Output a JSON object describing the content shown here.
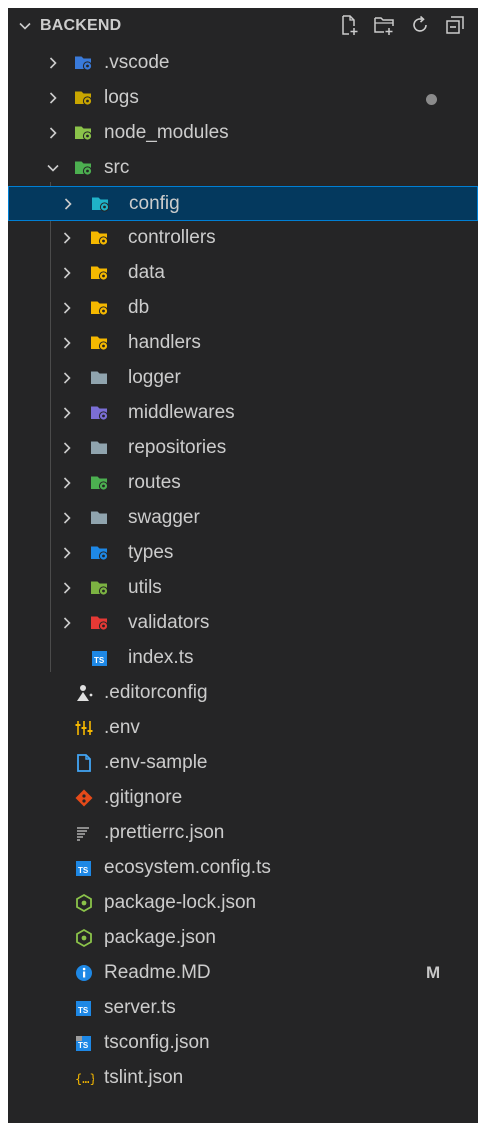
{
  "explorer": {
    "title": "BACKEND",
    "actions": [
      {
        "name": "new-file-icon"
      },
      {
        "name": "new-folder-icon"
      },
      {
        "name": "refresh-icon"
      },
      {
        "name": "collapse-all-icon"
      }
    ]
  },
  "tree": [
    {
      "label": ".vscode",
      "type": "folder",
      "expanded": false,
      "depth": 1,
      "icon": "folder-vscode-icon",
      "color": "#3a7ad9"
    },
    {
      "label": "logs",
      "type": "folder",
      "expanded": false,
      "depth": 1,
      "icon": "folder-logs-icon",
      "color": "#c9a600",
      "dot": true
    },
    {
      "label": "node_modules",
      "type": "folder",
      "expanded": false,
      "depth": 1,
      "icon": "folder-node-icon",
      "color": "#8bc34a"
    },
    {
      "label": "src",
      "type": "folder",
      "expanded": true,
      "depth": 1,
      "icon": "folder-src-icon",
      "color": "#4caf50"
    },
    {
      "label": "config",
      "type": "folder",
      "expanded": false,
      "depth": 2,
      "icon": "folder-config-icon",
      "color": "#20b2c8",
      "selected": true
    },
    {
      "label": "controllers",
      "type": "folder",
      "expanded": false,
      "depth": 2,
      "icon": "folder-controllers-icon",
      "color": "#f5b800"
    },
    {
      "label": "data",
      "type": "folder",
      "expanded": false,
      "depth": 2,
      "icon": "folder-data-icon",
      "color": "#f5b800"
    },
    {
      "label": "db",
      "type": "folder",
      "expanded": false,
      "depth": 2,
      "icon": "folder-db-icon",
      "color": "#f5b800"
    },
    {
      "label": "handlers",
      "type": "folder",
      "expanded": false,
      "depth": 2,
      "icon": "folder-handlers-icon",
      "color": "#f5b800"
    },
    {
      "label": "logger",
      "type": "folder",
      "expanded": false,
      "depth": 2,
      "icon": "folder-icon",
      "color": "#90a4ae"
    },
    {
      "label": "middlewares",
      "type": "folder",
      "expanded": false,
      "depth": 2,
      "icon": "folder-middlewares-icon",
      "color": "#7b6fd6"
    },
    {
      "label": "repositories",
      "type": "folder",
      "expanded": false,
      "depth": 2,
      "icon": "folder-icon",
      "color": "#90a4ae"
    },
    {
      "label": "routes",
      "type": "folder",
      "expanded": false,
      "depth": 2,
      "icon": "folder-routes-icon",
      "color": "#4caf50"
    },
    {
      "label": "swagger",
      "type": "folder",
      "expanded": false,
      "depth": 2,
      "icon": "folder-icon",
      "color": "#90a4ae"
    },
    {
      "label": "types",
      "type": "folder",
      "expanded": false,
      "depth": 2,
      "icon": "folder-types-icon",
      "color": "#1e88e5"
    },
    {
      "label": "utils",
      "type": "folder",
      "expanded": false,
      "depth": 2,
      "icon": "folder-utils-icon",
      "color": "#7cb342"
    },
    {
      "label": "validators",
      "type": "folder",
      "expanded": false,
      "depth": 2,
      "icon": "folder-validators-icon",
      "color": "#e53935"
    },
    {
      "label": "index.ts",
      "type": "file",
      "depth": 2,
      "icon": "typescript-icon",
      "color": "#1e88e5"
    },
    {
      "label": ".editorconfig",
      "type": "file",
      "depth": 1,
      "icon": "editorconfig-icon",
      "color": "#e0e0e0"
    },
    {
      "label": ".env",
      "type": "file",
      "depth": 1,
      "icon": "env-icon",
      "color": "#f5b800"
    },
    {
      "label": ".env-sample",
      "type": "file",
      "depth": 1,
      "icon": "file-icon",
      "color": "#42a5f5"
    },
    {
      "label": ".gitignore",
      "type": "file",
      "depth": 1,
      "icon": "git-icon",
      "color": "#e64a19"
    },
    {
      "label": ".prettierrc.json",
      "type": "file",
      "depth": 1,
      "icon": "prettier-icon",
      "color": "#8d8d8d"
    },
    {
      "label": "ecosystem.config.ts",
      "type": "file",
      "depth": 1,
      "icon": "typescript-icon",
      "color": "#1e88e5"
    },
    {
      "label": "package-lock.json",
      "type": "file",
      "depth": 1,
      "icon": "nodejs-icon",
      "color": "#8bc34a"
    },
    {
      "label": "package.json",
      "type": "file",
      "depth": 1,
      "icon": "nodejs-icon",
      "color": "#8bc34a"
    },
    {
      "label": "Readme.MD",
      "type": "file",
      "depth": 1,
      "icon": "info-icon",
      "color": "#1e88e5",
      "badge": "M"
    },
    {
      "label": "server.ts",
      "type": "file",
      "depth": 1,
      "icon": "typescript-icon",
      "color": "#1e88e5"
    },
    {
      "label": "tsconfig.json",
      "type": "file",
      "depth": 1,
      "icon": "tsconfig-icon",
      "color": "#1e88e5"
    },
    {
      "label": "tslint.json",
      "type": "file",
      "depth": 1,
      "icon": "json-icon",
      "color": "#f5b800"
    }
  ]
}
